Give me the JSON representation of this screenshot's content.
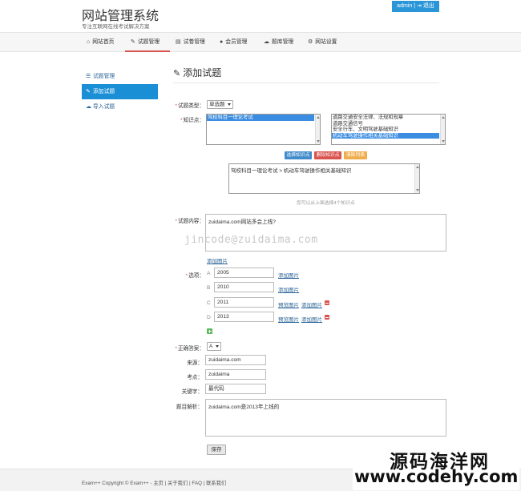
{
  "header": {
    "title": "网站管理系统",
    "subtitle": "专注互联网在线考试解决方案",
    "admin_label": "admin",
    "logout_label": "退出"
  },
  "nav": {
    "items": [
      {
        "label": "网站首页",
        "icon": "home-icon"
      },
      {
        "label": "试题管理",
        "icon": "edit-icon"
      },
      {
        "label": "试卷管理",
        "icon": "file-icon"
      },
      {
        "label": "会员管理",
        "icon": "user-icon"
      },
      {
        "label": "题库管理",
        "icon": "cloud-icon"
      },
      {
        "label": "网站设置",
        "icon": "cogs-icon"
      }
    ]
  },
  "sidebar": {
    "items": [
      {
        "label": "试题管理"
      },
      {
        "label": "添加试题"
      },
      {
        "label": "导入试题"
      }
    ]
  },
  "page_title": "添加试题",
  "form": {
    "type_label": "试题类型：",
    "type_value": "单选题",
    "knowledge_label": "知识点：",
    "left_list": [
      "驾校科目一理论考试"
    ],
    "right_list": [
      "道路交通安全法律、法规和规章",
      "道路交通信号",
      "安全行车、文明驾驶基础知识",
      "机动车驾驶操作相关基础知识"
    ],
    "btn_select": "选择知识点",
    "btn_delete": "删除知识点",
    "btn_clear": "清除列表",
    "selected_text": "驾校科目一理论考试 > 机动车驾驶操作相关基础知识",
    "hint": "您可以从上面选择4个知识点",
    "content_label": "试题内容：",
    "content_value": "zuidaima.com网站多会上线?",
    "watermark": "jincode@zuidaima.com",
    "add_image": "添加图片",
    "options_label": "选项：",
    "preview_image": "预览图片",
    "options": [
      {
        "letter": "A",
        "value": "2005"
      },
      {
        "letter": "B",
        "value": "2010"
      },
      {
        "letter": "C",
        "value": "2011"
      },
      {
        "letter": "D",
        "value": "2013"
      }
    ],
    "answer_label": "正确答案：",
    "answer_value": "A",
    "source_label": "来源：",
    "source_value": "zuidaima.com",
    "point_label": "考点：",
    "point_value": "zuidaima",
    "keyword_label": "关键字：",
    "keyword_value": "最代码",
    "analysis_label": "题目解析：",
    "analysis_value": "zuidaima.com是2013年上线的",
    "save_label": "保存"
  },
  "footer": {
    "text": "Exam++ Copyright © Exam++ - 主页 | 关于我们 | FAQ | 联系我们"
  },
  "stamp": {
    "line1": "源码海洋网",
    "line2": "www.codehy.com"
  }
}
